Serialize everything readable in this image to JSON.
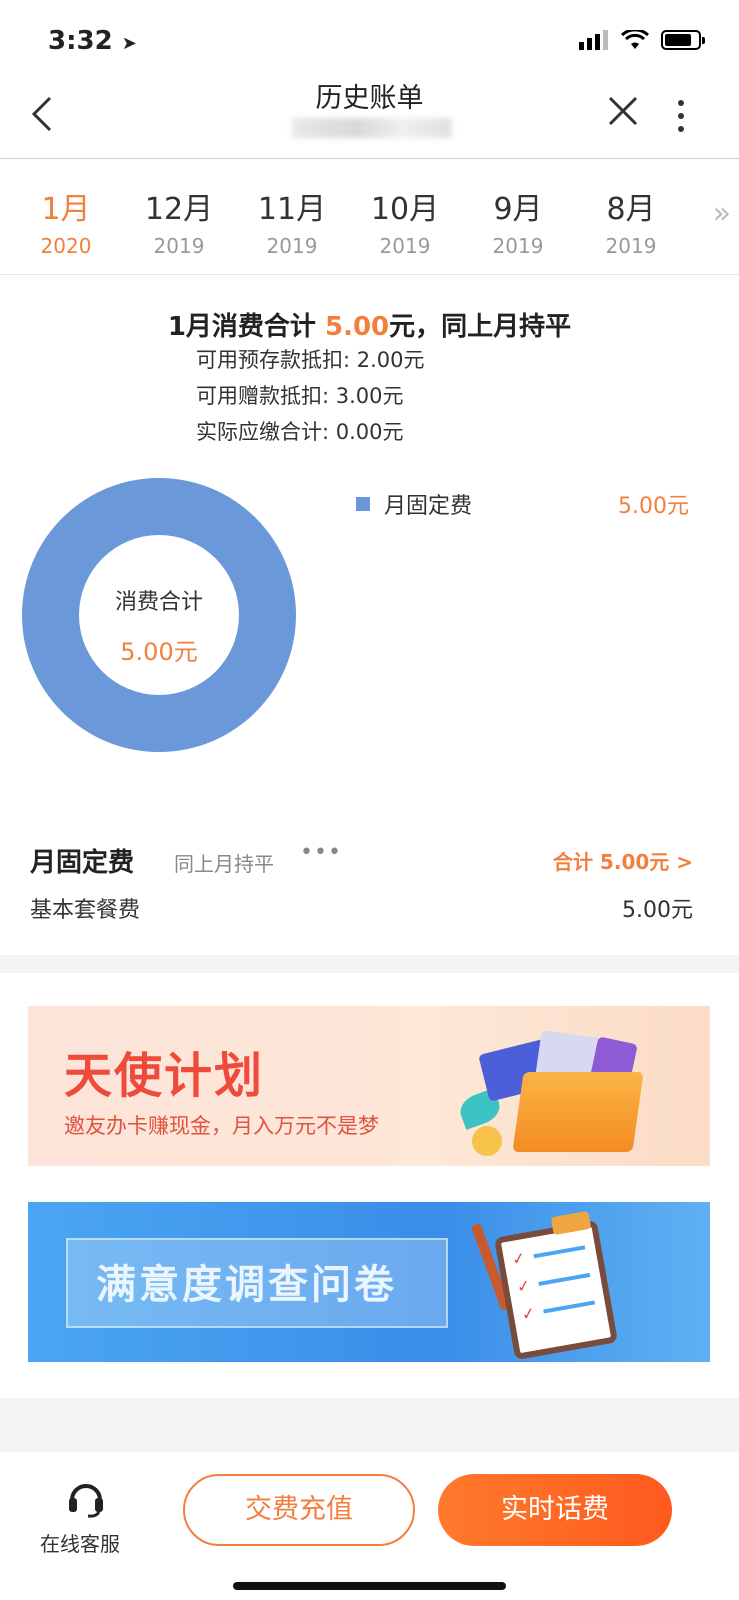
{
  "status_bar": {
    "time": "3:32"
  },
  "nav": {
    "title": "历史账单",
    "back_icon": "‹",
    "close_icon": "✕"
  },
  "months": [
    {
      "month": "1月",
      "year": "2020",
      "active": true
    },
    {
      "month": "12月",
      "year": "2019"
    },
    {
      "month": "11月",
      "year": "2019"
    },
    {
      "month": "10月",
      "year": "2019"
    },
    {
      "month": "9月",
      "year": "2019"
    },
    {
      "month": "8月",
      "year": "2019"
    }
  ],
  "months_more_icon": "»",
  "summary": {
    "title_prefix": "1月消费合计 ",
    "title_amount": "5.00",
    "title_suffix": "元，同上月持平",
    "prepaid": "可用预存款抵扣: 2.00元",
    "bonus": "可用赠款抵扣: 3.00元",
    "actual": "实际应缴合计: 0.00元"
  },
  "donut": {
    "center_label": "消费合计",
    "center_value": "5.00元",
    "color": "#6a98d8"
  },
  "legend": [
    {
      "label": "月固定费",
      "value": "5.00元",
      "color": "#6a98d8"
    }
  ],
  "fee_section": {
    "title": "月固定费",
    "comparison": "同上月持平",
    "dots": "•••",
    "total": "合计  5.00元 >",
    "items": [
      {
        "name": "基本套餐费",
        "value": "5.00元"
      }
    ]
  },
  "banners": {
    "angel_title": "天使计划",
    "angel_sub": "邀友办卡赚现金，月入万元不是梦",
    "survey_title": "满意度调查问卷"
  },
  "bottom_bar": {
    "service_label": "在线客服",
    "pay_button": "交费充值",
    "realtime_button": "实时话费"
  },
  "colors": {
    "accent": "#f27f3d",
    "chart": "#6a98d8",
    "cta": "#ff6a24"
  }
}
